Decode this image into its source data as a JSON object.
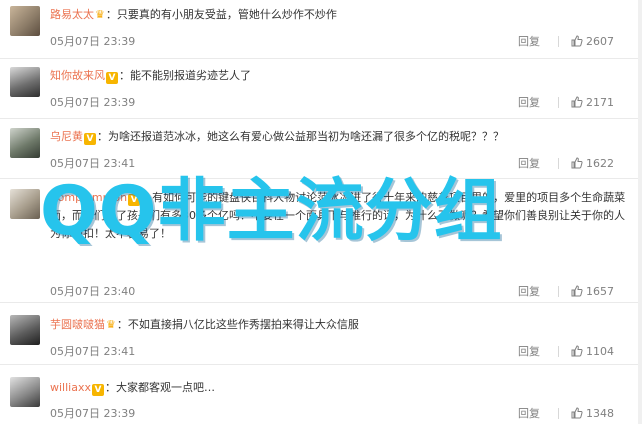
{
  "comments": [
    {
      "username": "路易太太",
      "badge": "crown",
      "text": "：只要真的有小朋友受益，管她什么炒作不炒作",
      "time": "05月07日 23:39",
      "reply": "回复",
      "likes": "2607"
    },
    {
      "username": "知你故来风",
      "badge": "v",
      "text": "：能不能别报道劣迹艺人了",
      "time": "05月07日 23:39",
      "reply": "回复",
      "likes": "2171"
    },
    {
      "username": "乌尼黄",
      "badge": "v",
      "text": "：为啥还报道范冰冰，她这么有爱心做公益那当初为啥还漏了很多个亿的税呢？？？",
      "time": "05月07日 23:41",
      "reply": "回复",
      "likes": "1622"
    },
    {
      "username": "Complemmon",
      "badge": "v",
      "text": "：有如何可能的键盘侠百科人物讨论范冰冰进了行十年来的慈善项目里的，爱里的项目多个生命蔬菜面，而你们为了孩子们有多30多个亿吗？不要在一个面具下与推行的话，为什么不做呢？希望你们善良别让关于你的人为你相扣！太不容易了！",
      "time": "05月07日 23:40",
      "reply": "回复",
      "likes": "1657"
    },
    {
      "username": "芋圆啵啵猫",
      "badge": "crown",
      "text": "：不如直接捐八亿比这些作秀摆拍来得让大众信服",
      "time": "05月07日 23:41",
      "reply": "回复",
      "likes": "1104"
    },
    {
      "username": "williaxx",
      "badge": "v",
      "text": "：大家都客观一点吧…",
      "time": "05月07日 23:39",
      "reply": "回复",
      "likes": "1348"
    }
  ],
  "watermark": "QQ非主流分组"
}
